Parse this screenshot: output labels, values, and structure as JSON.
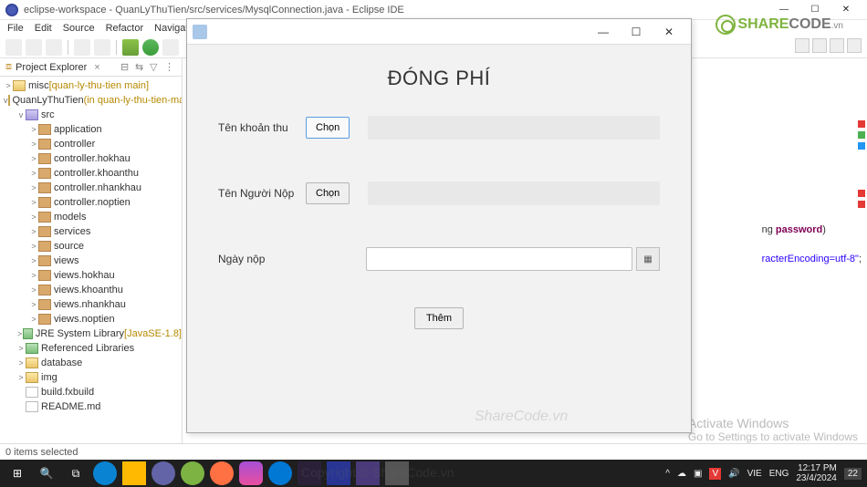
{
  "window": {
    "title": "eclipse-workspace - QuanLyThuTien/src/services/MysqlConnection.java - Eclipse IDE",
    "min_icon": "—",
    "max_icon": "☐",
    "close_icon": "✕"
  },
  "menu": [
    "File",
    "Edit",
    "Source",
    "Refactor",
    "Navigate"
  ],
  "explorer": {
    "title": "Project Explorer",
    "tree": [
      {
        "d": 0,
        "tw": ">",
        "ico": "proj",
        "label": "misc",
        "deco": "[quan-ly-thu-tien main]"
      },
      {
        "d": 0,
        "tw": "v",
        "ico": "proj",
        "label": "QuanLyThuTien",
        "deco": "(in quan-ly-thu-tien-master)"
      },
      {
        "d": 1,
        "tw": "v",
        "ico": "folds",
        "label": "src",
        "deco": ""
      },
      {
        "d": 2,
        "tw": ">",
        "ico": "pkg",
        "label": "application",
        "deco": ""
      },
      {
        "d": 2,
        "tw": ">",
        "ico": "pkg",
        "label": "controller",
        "deco": ""
      },
      {
        "d": 2,
        "tw": ">",
        "ico": "pkg",
        "label": "controller.hokhau",
        "deco": ""
      },
      {
        "d": 2,
        "tw": ">",
        "ico": "pkg",
        "label": "controller.khoanthu",
        "deco": ""
      },
      {
        "d": 2,
        "tw": ">",
        "ico": "pkg",
        "label": "controller.nhankhau",
        "deco": ""
      },
      {
        "d": 2,
        "tw": ">",
        "ico": "pkg",
        "label": "controller.noptien",
        "deco": ""
      },
      {
        "d": 2,
        "tw": ">",
        "ico": "pkg",
        "label": "models",
        "deco": ""
      },
      {
        "d": 2,
        "tw": ">",
        "ico": "pkg",
        "label": "services",
        "deco": ""
      },
      {
        "d": 2,
        "tw": ">",
        "ico": "pkg",
        "label": "source",
        "deco": ""
      },
      {
        "d": 2,
        "tw": ">",
        "ico": "pkg",
        "label": "views",
        "deco": ""
      },
      {
        "d": 2,
        "tw": ">",
        "ico": "pkg",
        "label": "views.hokhau",
        "deco": ""
      },
      {
        "d": 2,
        "tw": ">",
        "ico": "pkg",
        "label": "views.khoanthu",
        "deco": ""
      },
      {
        "d": 2,
        "tw": ">",
        "ico": "pkg",
        "label": "views.nhankhau",
        "deco": ""
      },
      {
        "d": 2,
        "tw": ">",
        "ico": "pkg",
        "label": "views.noptien",
        "deco": ""
      },
      {
        "d": 1,
        "tw": ">",
        "ico": "lib",
        "label": "JRE System Library",
        "deco": "[JavaSE-1.8]"
      },
      {
        "d": 1,
        "tw": ">",
        "ico": "lib",
        "label": "Referenced Libraries",
        "deco": ""
      },
      {
        "d": 1,
        "tw": ">",
        "ico": "fold",
        "label": "database",
        "deco": ""
      },
      {
        "d": 1,
        "tw": ">",
        "ico": "fold",
        "label": "img",
        "deco": ""
      },
      {
        "d": 1,
        "tw": "",
        "ico": "file",
        "label": "build.fxbuild",
        "deco": ""
      },
      {
        "d": 1,
        "tw": "",
        "ico": "file",
        "label": "README.md",
        "deco": ""
      }
    ]
  },
  "editor": {
    "snip1_a": "ng ",
    "snip1_b": "password)",
    "snip2_a": "racterEncoding=utf-8\"",
    "snip2_b": ";"
  },
  "dialog": {
    "title": "ĐÓNG PHÍ",
    "row1_label": "Tên khoản thu",
    "row1_btn": "Chọn",
    "row2_label": "Tên Người Nộp",
    "row2_btn": "Chọn",
    "row3_label": "Ngày nộp",
    "cal_icon": "▦",
    "submit": "Thêm",
    "min": "—",
    "max": "☐",
    "close": "✕"
  },
  "status": {
    "text": "0 items selected"
  },
  "logo": {
    "p1": "SHARE",
    "p2": "CODE",
    "tld": ".vn"
  },
  "watermark1": "ShareCode.vn",
  "watermark2": "Copyright © ShareCode.vn",
  "activate": {
    "t": "Activate Windows",
    "s": "Go to Settings to activate Windows"
  },
  "tray": {
    "lang1": "VIE",
    "lang2": "ENG",
    "time": "12:17 PM",
    "date": "23/4/2024",
    "badge": "22"
  }
}
